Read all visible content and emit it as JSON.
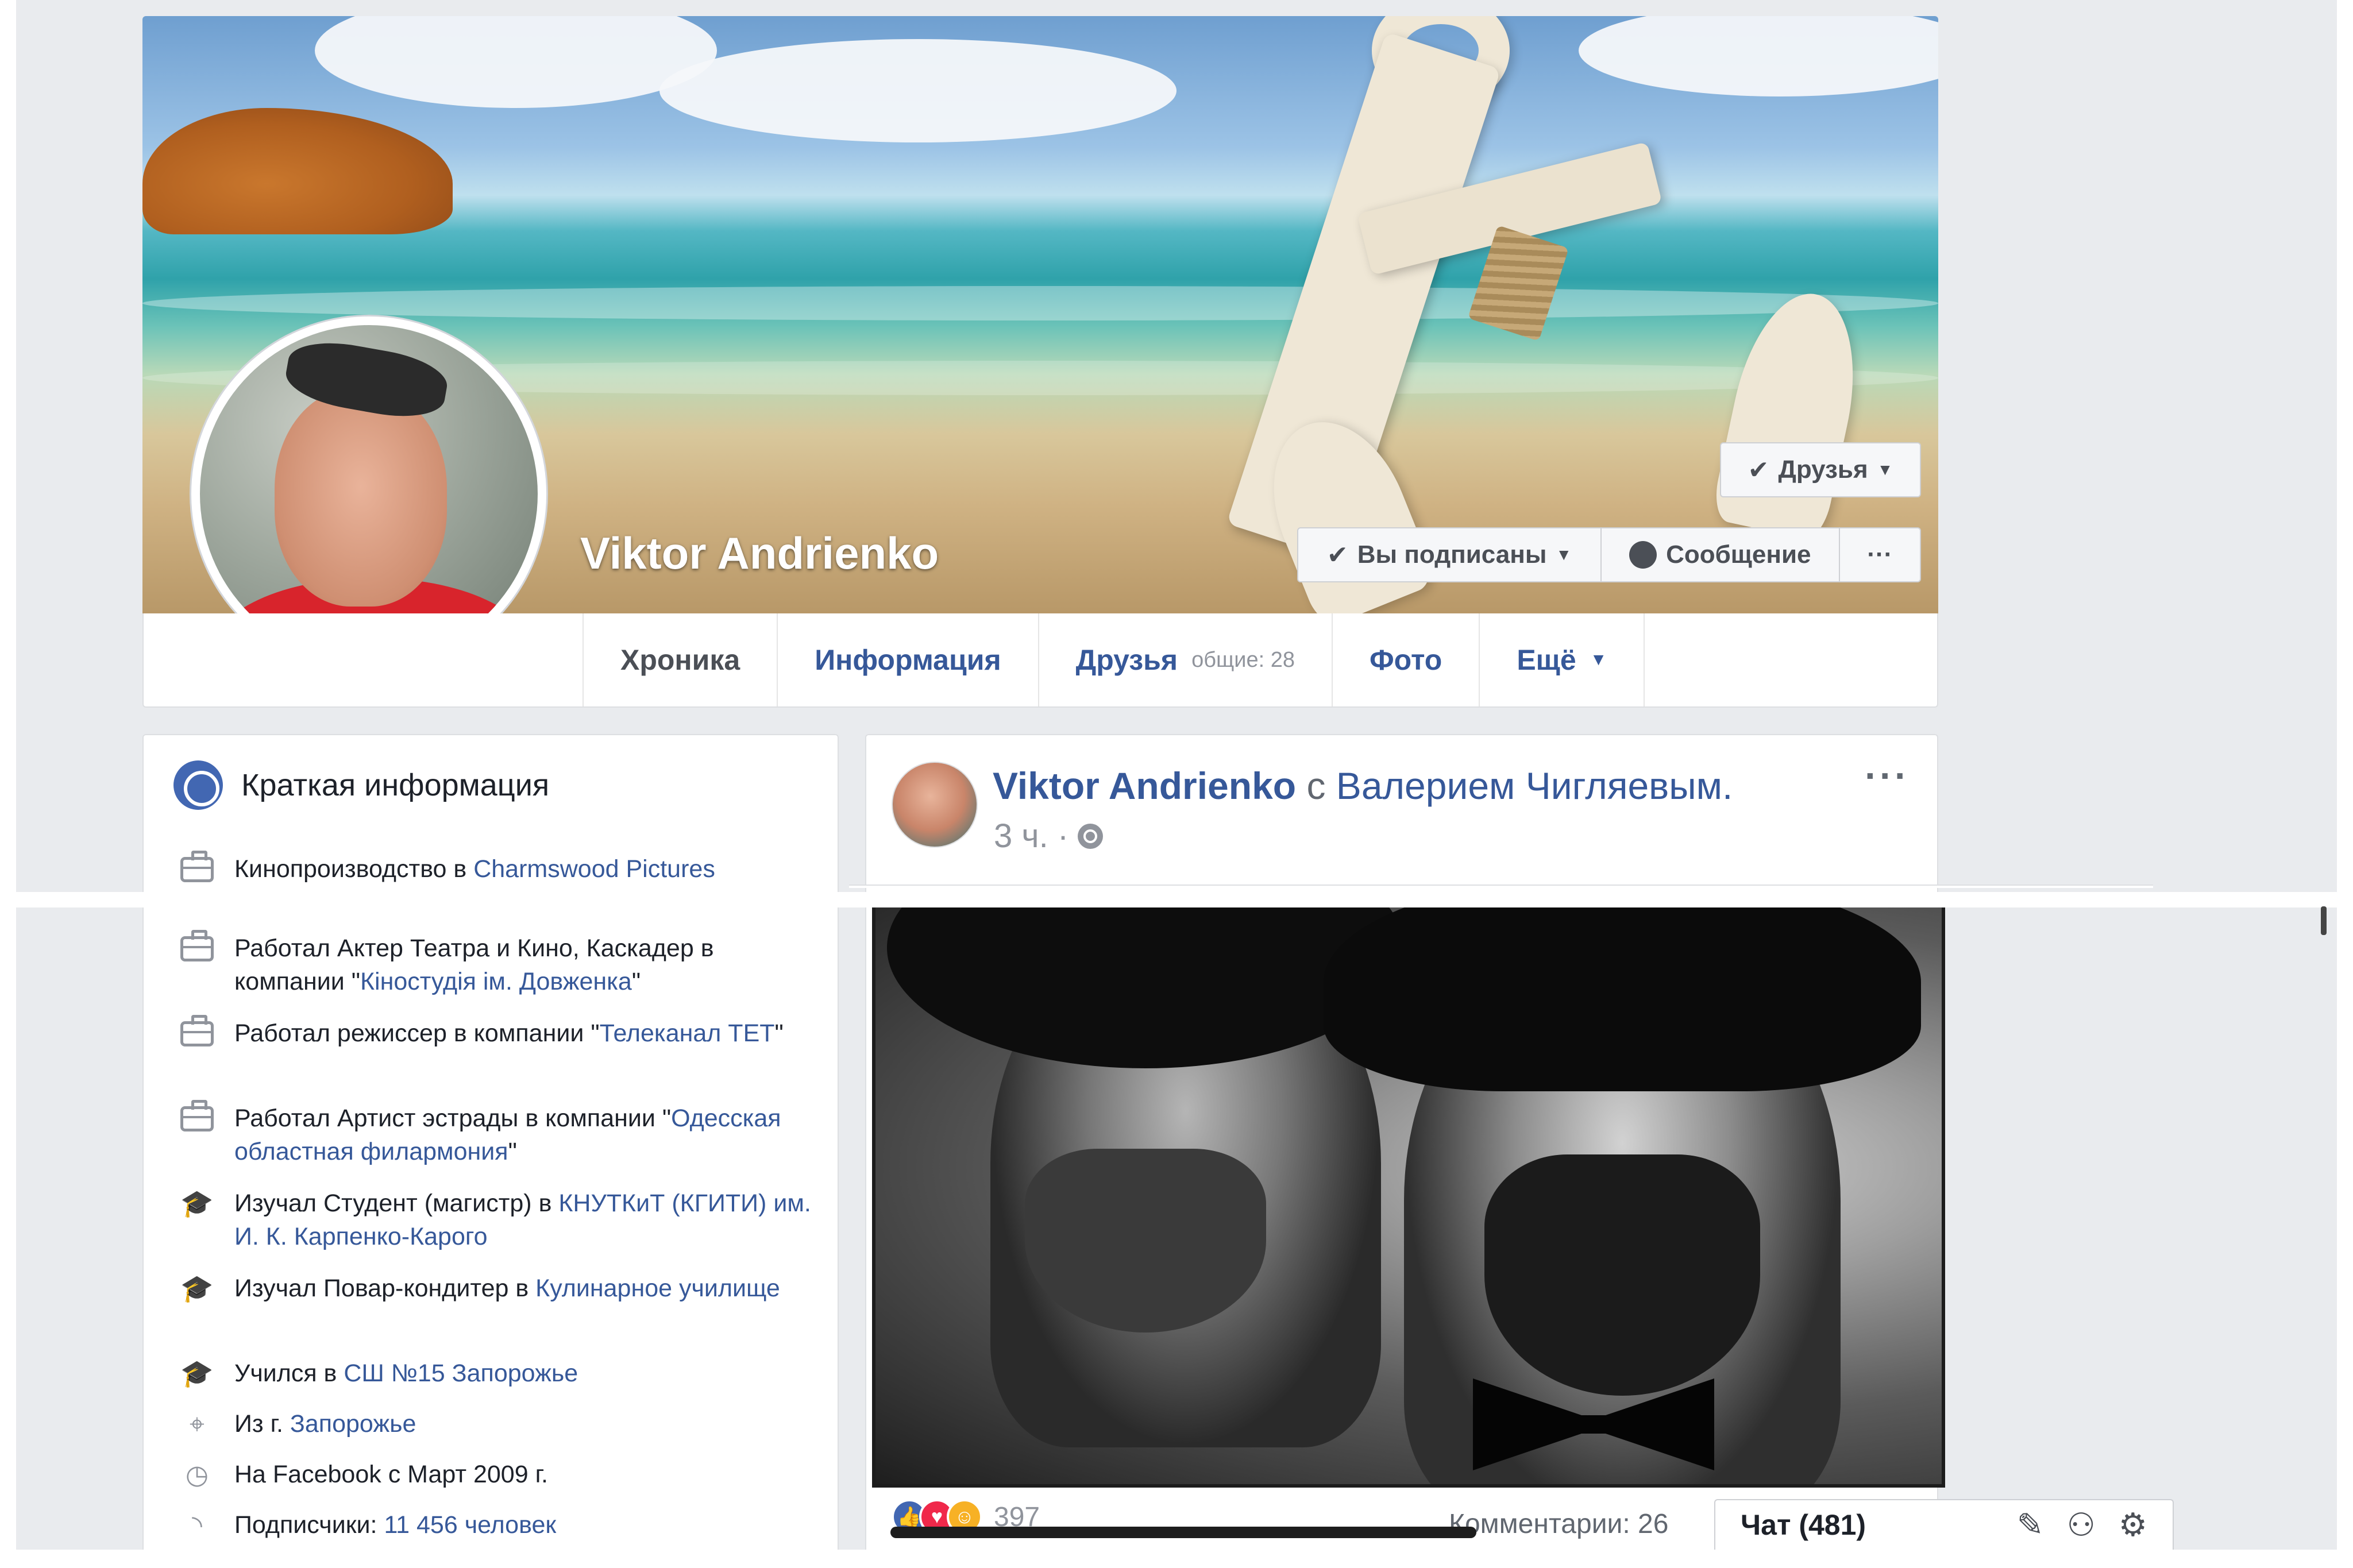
{
  "profile": {
    "name": "Viktor Andrienko",
    "friends_button": "Друзья",
    "subscribed_button": "Вы подписаны",
    "message_button": "Сообщение",
    "more_button": "···"
  },
  "tabs": [
    {
      "label": "Хроника"
    },
    {
      "label": "Информация"
    },
    {
      "label": "Друзья",
      "sub": "общие: 28"
    },
    {
      "label": "Фото"
    },
    {
      "label": "Ещё"
    }
  ],
  "intro": {
    "title": "Краткая информация",
    "rows": [
      {
        "icon": "briefcase-icon",
        "text": "Кинопроизводство в ",
        "link": "Charmswood Pictures",
        "after": ""
      },
      {
        "icon": "briefcase-icon",
        "text": "Работал Актер Театра и Кино, Каскадер в компании \"",
        "link": "Кіностудія ім. Довженка",
        "after": "\""
      },
      {
        "icon": "briefcase-icon",
        "text": "Работал режиссер в компании \"",
        "link": "Телеканал ТЕТ",
        "after": "\""
      },
      {
        "icon": "briefcase-icon",
        "text": "Работал Артист эстрады в компании \"",
        "link": "Одесская областная филармония",
        "after": "\""
      },
      {
        "icon": "graduation-cap-icon",
        "text": "Изучал Студент (магистр) в ",
        "link": "КНУТКиТ (КГИТИ) им. И. К. Карпенко-Карого",
        "after": ""
      },
      {
        "icon": "graduation-cap-icon",
        "text": "Изучал Повар-кондитер в ",
        "link": "Кулинарное училище",
        "after": ""
      },
      {
        "icon": "graduation-cap-icon",
        "text": "Учился в ",
        "link": "СШ №15 Запорожье",
        "after": ""
      },
      {
        "icon": "location-pin-icon",
        "text": "Из г. ",
        "link": "Запорожье",
        "after": ""
      },
      {
        "icon": "clock-icon",
        "text": "На Facebook с Март 2009 г.",
        "link": "",
        "after": ""
      },
      {
        "icon": "rss-icon",
        "text": "Подписчики: ",
        "link": "11 456 человек",
        "after": ""
      }
    ]
  },
  "post": {
    "author": "Viktor Andrienko",
    "with_text": "с",
    "tagged": "Валерием Чигляевым.",
    "time": "3 ч. ·",
    "options": "···",
    "reaction_count": "397",
    "comments": "Комментарии: 26"
  },
  "chat": {
    "label": "Чат (481)"
  },
  "colors": {
    "link_blue": "#365899",
    "page_bg": "#e9ebee",
    "like_blue": "#4267b2",
    "love_red": "#f0284a",
    "haha_yellow": "#f7b125"
  }
}
